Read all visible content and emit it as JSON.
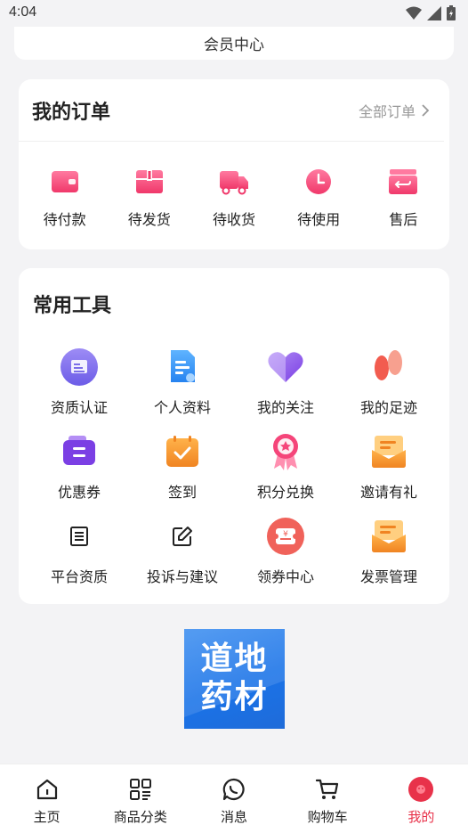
{
  "status": {
    "time": "4:04"
  },
  "member": {
    "label": "会员中心"
  },
  "orders": {
    "title": "我的订单",
    "all_label": "全部订单",
    "items": [
      {
        "label": "待付款",
        "icon": "wallet-icon"
      },
      {
        "label": "待发货",
        "icon": "package-icon"
      },
      {
        "label": "待收货",
        "icon": "truck-icon"
      },
      {
        "label": "待使用",
        "icon": "clock-icon"
      },
      {
        "label": "售后",
        "icon": "return-box-icon"
      }
    ]
  },
  "tools": {
    "title": "常用工具",
    "items": [
      {
        "label": "资质认证",
        "icon": "certificate-icon"
      },
      {
        "label": "个人资料",
        "icon": "profile-doc-icon"
      },
      {
        "label": "我的关注",
        "icon": "heart-icon"
      },
      {
        "label": "我的足迹",
        "icon": "footprint-icon"
      },
      {
        "label": "优惠券",
        "icon": "coupon-icon"
      },
      {
        "label": "签到",
        "icon": "checkin-icon"
      },
      {
        "label": "积分兑换",
        "icon": "points-badge-icon"
      },
      {
        "label": "邀请有礼",
        "icon": "invite-gift-icon"
      },
      {
        "label": "平台资质",
        "icon": "platform-doc-icon"
      },
      {
        "label": "投诉与建议",
        "icon": "edit-icon"
      },
      {
        "label": "领券中心",
        "icon": "coupon-center-icon"
      },
      {
        "label": "发票管理",
        "icon": "invoice-icon"
      }
    ]
  },
  "logo": {
    "line1": "道地",
    "line2": "药材"
  },
  "tabbar": {
    "items": [
      {
        "label": "主页",
        "icon": "home-icon",
        "active": false
      },
      {
        "label": "商品分类",
        "icon": "category-icon",
        "active": false
      },
      {
        "label": "消息",
        "icon": "message-icon",
        "active": false
      },
      {
        "label": "购物车",
        "icon": "cart-icon",
        "active": false
      },
      {
        "label": "我的",
        "icon": "mine-icon",
        "active": true
      }
    ]
  },
  "colors": {
    "accent": "#e8324a",
    "pink": "#f5457a",
    "orange": "#f5912f",
    "purple": "#7b4fe0",
    "blue": "#2b8ff0"
  }
}
